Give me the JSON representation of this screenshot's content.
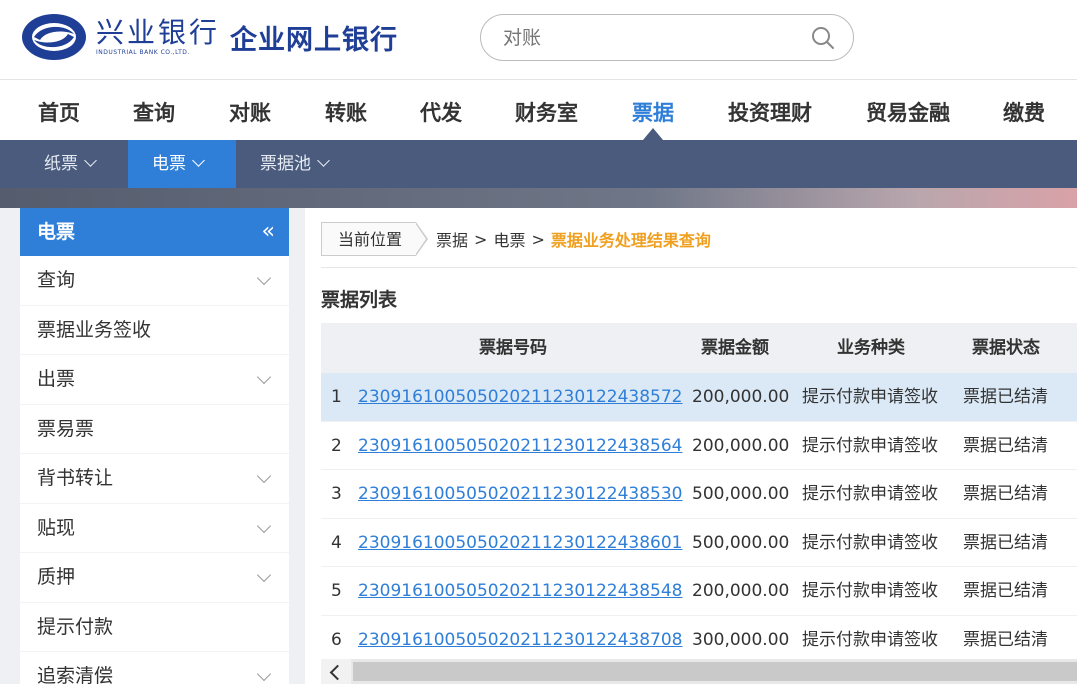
{
  "header": {
    "bank_name": "兴业银行",
    "bank_name_en": "INDUSTRIAL BANK CO.,LTD.",
    "system_name": "企业网上银行",
    "search_placeholder": "对账",
    "brand_color": "#1f3f97"
  },
  "main_nav": {
    "items": [
      {
        "label": "首页"
      },
      {
        "label": "查询"
      },
      {
        "label": "对账"
      },
      {
        "label": "转账"
      },
      {
        "label": "代发"
      },
      {
        "label": "财务室"
      },
      {
        "label": "票据",
        "active": true
      },
      {
        "label": "投资理财"
      },
      {
        "label": "贸易金融"
      },
      {
        "label": "缴费"
      }
    ],
    "active_color": "#2f7fd9"
  },
  "sub_nav": {
    "items": [
      {
        "label": "纸票"
      },
      {
        "label": "电票",
        "active": true
      },
      {
        "label": "票据池"
      }
    ],
    "bg_color": "#4a5b7d"
  },
  "sidebar": {
    "title": "电票",
    "collapse_icon": "«",
    "items": [
      {
        "label": "查询",
        "expandable": true
      },
      {
        "label": "票据业务签收",
        "expandable": false
      },
      {
        "label": "出票",
        "expandable": true
      },
      {
        "label": "票易票",
        "expandable": false
      },
      {
        "label": "背书转让",
        "expandable": true
      },
      {
        "label": "贴现",
        "expandable": true
      },
      {
        "label": "质押",
        "expandable": true
      },
      {
        "label": "提示付款",
        "expandable": false
      },
      {
        "label": "追索清偿",
        "expandable": true
      }
    ]
  },
  "breadcrumb": {
    "label": "当前位置",
    "path": [
      "票据",
      "电票"
    ],
    "separator": ">",
    "current": "票据业务处理结果查询",
    "current_color": "#f0a020"
  },
  "list_title": "票据列表",
  "table": {
    "columns": [
      "票据号码",
      "票据金额",
      "业务种类",
      "票据状态"
    ],
    "rows": [
      {
        "index": "1",
        "bill_no": "230916100505020211230122438572",
        "amount": "200,000.00",
        "type": "提示付款申请签收",
        "status": "票据已结清"
      },
      {
        "index": "2",
        "bill_no": "230916100505020211230122438564",
        "amount": "200,000.00",
        "type": "提示付款申请签收",
        "status": "票据已结清"
      },
      {
        "index": "3",
        "bill_no": "230916100505020211230122438530",
        "amount": "500,000.00",
        "type": "提示付款申请签收",
        "status": "票据已结清"
      },
      {
        "index": "4",
        "bill_no": "230916100505020211230122438601",
        "amount": "500,000.00",
        "type": "提示付款申请签收",
        "status": "票据已结清"
      },
      {
        "index": "5",
        "bill_no": "230916100505020211230122438548",
        "amount": "200,000.00",
        "type": "提示付款申请签收",
        "status": "票据已结清"
      },
      {
        "index": "6",
        "bill_no": "230916100505020211230122438708",
        "amount": "300,000.00",
        "type": "提示付款申请签收",
        "status": "票据已结清"
      }
    ]
  }
}
